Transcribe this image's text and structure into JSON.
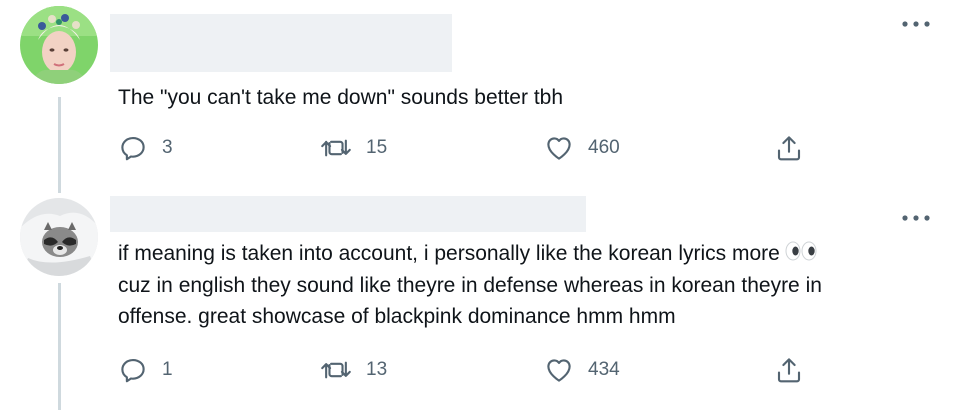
{
  "tweets": [
    {
      "text": "The \"you can't take me down\" sounds better tbh",
      "reply_count": "3",
      "retweet_count": "15",
      "like_count": "460"
    },
    {
      "text_line1": "if meaning is taken into account, i personally like the korean lyrics more",
      "text_line2": "cuz in english they sound like theyre in defense whereas in korean theyre in",
      "text_line3": "offense. great showcase of blackpink dominance hmm hmm",
      "emoji": "eyes-emoji",
      "reply_count": "1",
      "retweet_count": "13",
      "like_count": "434"
    }
  ],
  "icons": {
    "reply": "reply-icon",
    "retweet": "retweet-icon",
    "like": "heart-icon",
    "share": "share-icon",
    "more": "more-options-icon"
  },
  "colors": {
    "text": "#0f1419",
    "secondary": "#536471",
    "thread_line": "#cfd9de",
    "redacted_block": "#eef1f4"
  }
}
